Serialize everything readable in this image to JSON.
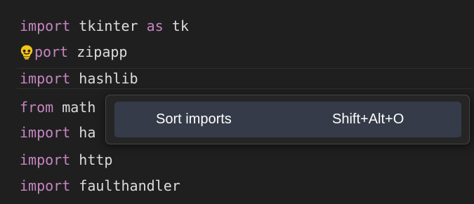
{
  "code_lines": [
    {
      "keyword": "import",
      "name": "tkinter",
      "extra_kw": "as",
      "alias": "tk"
    },
    {
      "keyword_partial": "port",
      "name": "zipapp"
    },
    {
      "keyword": "import",
      "name": "hashlib"
    },
    {
      "keyword": "from",
      "name": "math"
    },
    {
      "keyword": "import",
      "name": "ha"
    },
    {
      "keyword": "import",
      "name": "http"
    },
    {
      "keyword": "import",
      "name": "faulthandler"
    }
  ],
  "context_menu": {
    "item_label": "Sort imports",
    "item_shortcut": "Shift+Alt+O"
  },
  "icons": {
    "lightbulb": "lightbulb-icon"
  },
  "colors": {
    "background": "#1f1f1f",
    "keyword": "#c586c0",
    "identifier": "#dcdcdc",
    "lightbulb": "#f5c518",
    "menu_background": "#252526",
    "menu_item_highlight": "#353b48"
  }
}
